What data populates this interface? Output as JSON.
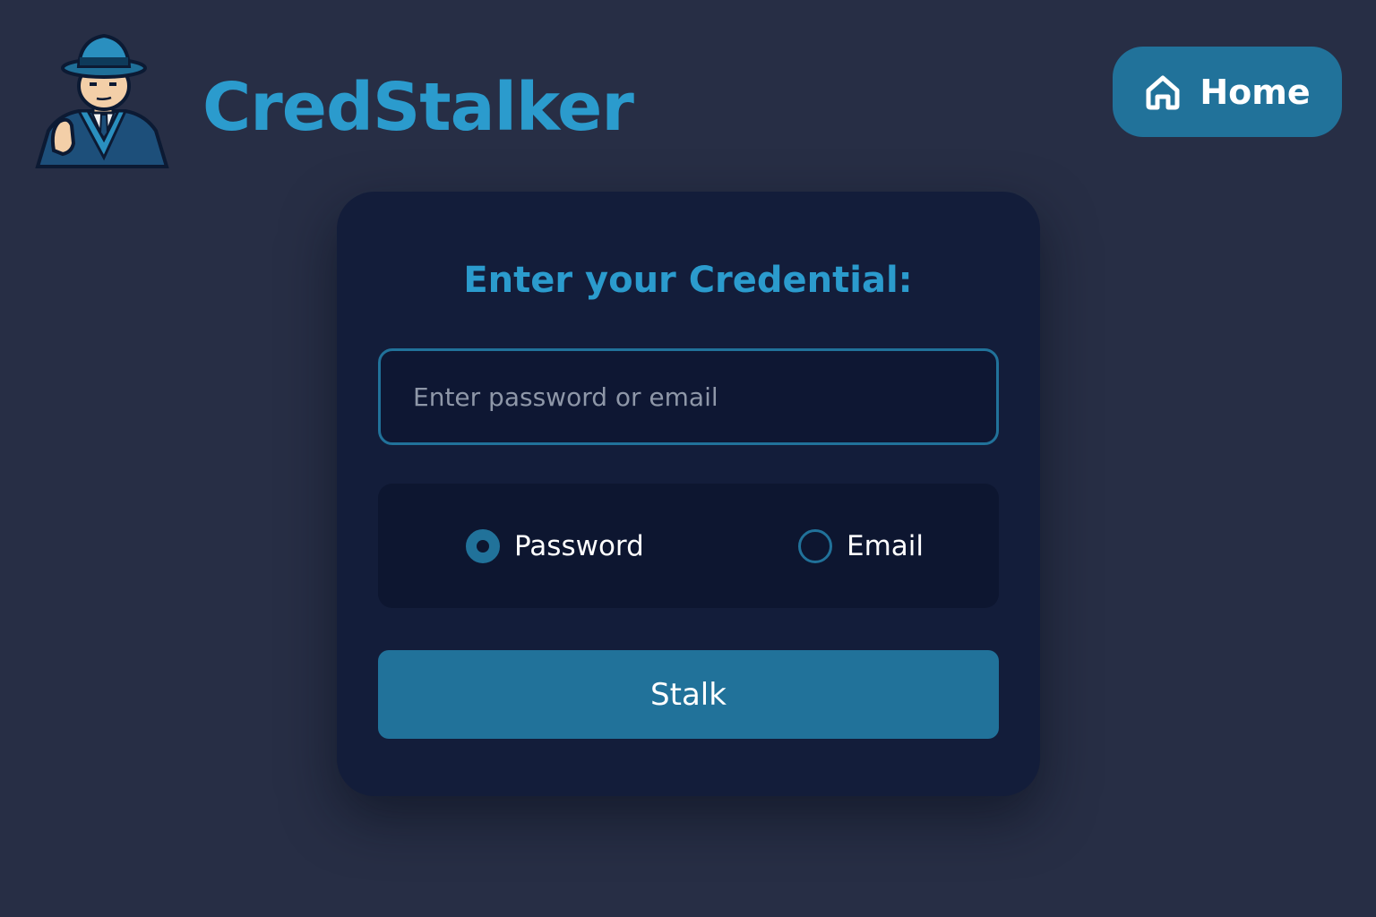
{
  "header": {
    "logo_icon": "detective-icon",
    "app_title": "CredStalker",
    "home_button": {
      "icon": "home-icon",
      "label": "Home"
    }
  },
  "form": {
    "title": "Enter your Credential:",
    "input": {
      "placeholder": "Enter password or email",
      "value": ""
    },
    "type_options": [
      {
        "label": "Password",
        "selected": true
      },
      {
        "label": "Email",
        "selected": false
      }
    ],
    "submit_label": "Stalk"
  },
  "colors": {
    "background": "#272e45",
    "card": "#131d3a",
    "accent": "#21729a",
    "title_text": "#2b9bcd"
  }
}
